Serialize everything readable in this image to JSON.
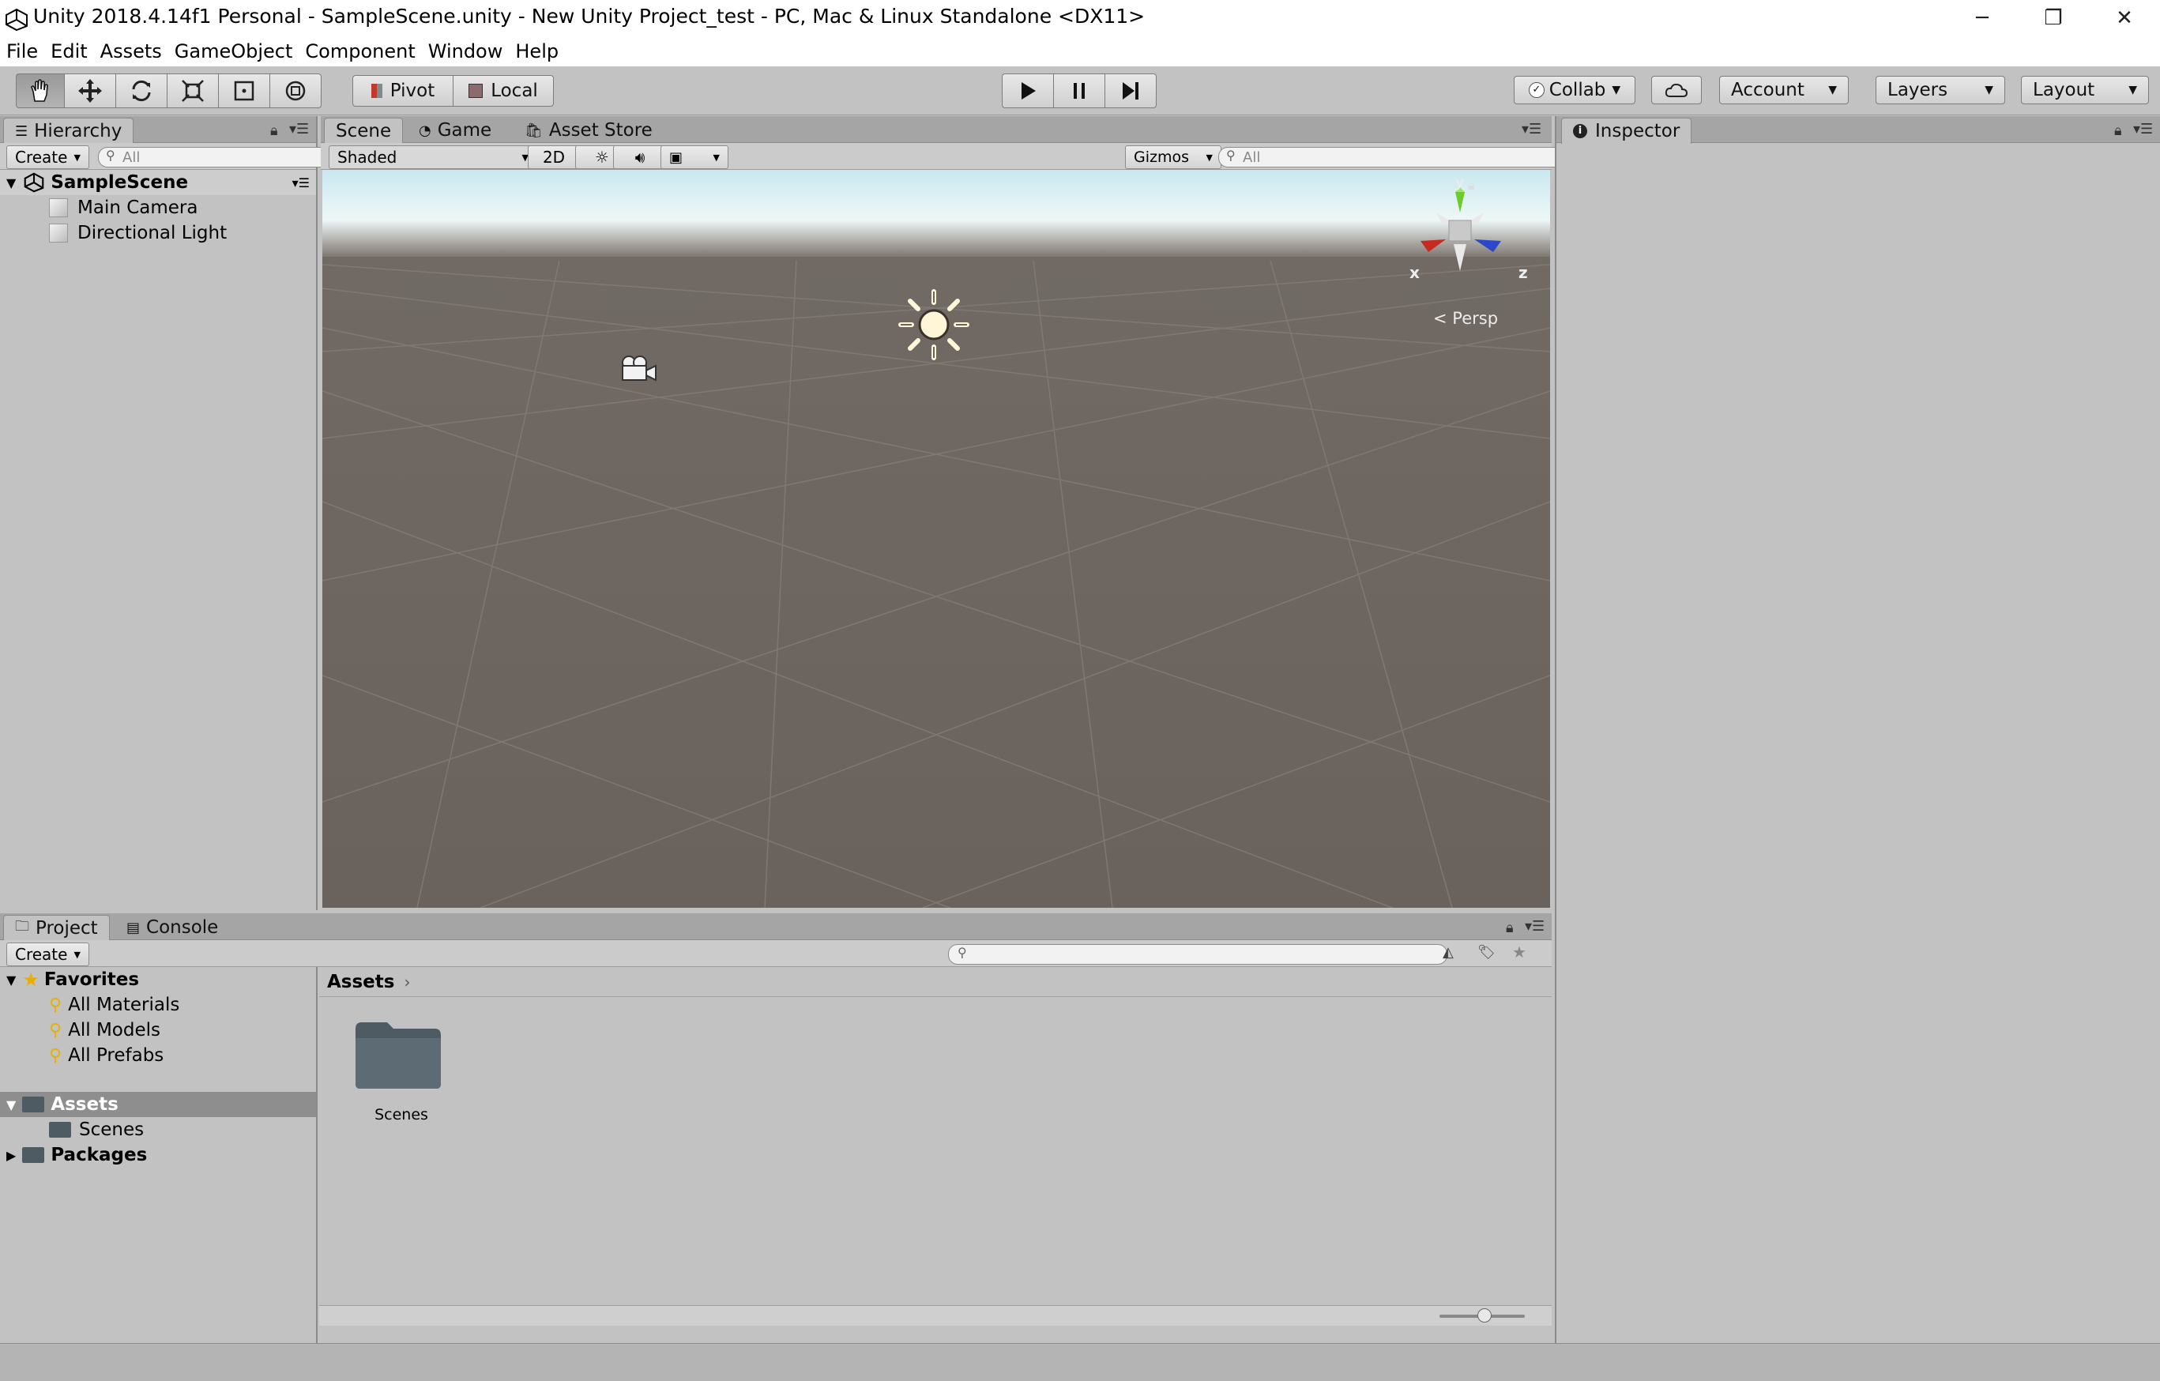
{
  "window": {
    "title": "Unity 2018.4.14f1 Personal - SampleScene.unity - New Unity Project_test - PC, Mac & Linux Standalone <DX11>",
    "minimize": "─",
    "maximize": "❐",
    "close": "✕"
  },
  "menu": [
    "File",
    "Edit",
    "Assets",
    "GameObject",
    "Component",
    "Window",
    "Help"
  ],
  "toolbar": {
    "pivot": "Pivot",
    "local": "Local",
    "collab": "Collab",
    "account": "Account",
    "layers": "Layers",
    "layout": "Layout"
  },
  "hierarchy": {
    "tab": "Hierarchy",
    "create": "Create",
    "search_placeholder": "All",
    "scene": "SampleScene",
    "items": [
      "Main Camera",
      "Directional Light"
    ]
  },
  "scene_view": {
    "tabs": [
      "Scene",
      "Game",
      "Asset Store"
    ],
    "shading": "Shaded",
    "mode_2d": "2D",
    "gizmos": "Gizmos",
    "search_placeholder": "All",
    "projection": "Persp",
    "axes": {
      "x": "x",
      "y": "y",
      "z": "z"
    }
  },
  "inspector": {
    "tab": "Inspector"
  },
  "project": {
    "tabs": [
      "Project",
      "Console"
    ],
    "create": "Create",
    "favorites": "Favorites",
    "favorite_items": [
      "All Materials",
      "All Models",
      "All Prefabs"
    ],
    "assets": "Assets",
    "asset_children": [
      "Scenes"
    ],
    "packages": "Packages",
    "breadcrumb": "Assets",
    "folders": [
      "Scenes"
    ]
  }
}
